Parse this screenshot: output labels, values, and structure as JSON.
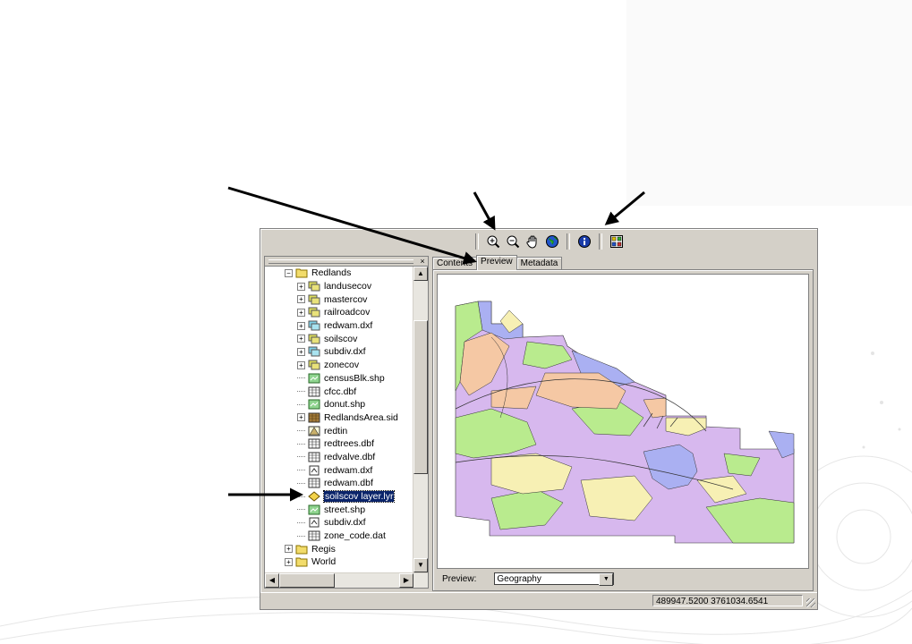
{
  "toolbar": {
    "buttons": [
      {
        "name": "zoom-in-icon"
      },
      {
        "name": "zoom-out-icon"
      },
      {
        "name": "pan-hand-icon"
      },
      {
        "name": "full-extent-globe-icon"
      },
      {
        "name": "identify-icon"
      },
      {
        "name": "create-thumbnail-icon"
      }
    ]
  },
  "tree": {
    "close_label": "×",
    "items": [
      {
        "label": "Redlands",
        "indent": 0,
        "expander": "-",
        "icon": "folder"
      },
      {
        "label": "landusecov",
        "indent": 1,
        "expander": "+",
        "icon": "coverage"
      },
      {
        "label": "mastercov",
        "indent": 1,
        "expander": "+",
        "icon": "coverage"
      },
      {
        "label": "railroadcov",
        "indent": 1,
        "expander": "+",
        "icon": "coverage"
      },
      {
        "label": "redwam.dxf",
        "indent": 1,
        "expander": "+",
        "icon": "cad"
      },
      {
        "label": "soilscov",
        "indent": 1,
        "expander": "+",
        "icon": "coverage"
      },
      {
        "label": "subdiv.dxf",
        "indent": 1,
        "expander": "+",
        "icon": "cad"
      },
      {
        "label": "zonecov",
        "indent": 1,
        "expander": "+",
        "icon": "coverage"
      },
      {
        "label": "censusBlk.shp",
        "indent": 1,
        "expander": "",
        "icon": "shapefile"
      },
      {
        "label": "cfcc.dbf",
        "indent": 1,
        "expander": "",
        "icon": "table"
      },
      {
        "label": "donut.shp",
        "indent": 1,
        "expander": "",
        "icon": "shapefile"
      },
      {
        "label": "RedlandsArea.sid",
        "indent": 1,
        "expander": "+",
        "icon": "raster"
      },
      {
        "label": "redtin",
        "indent": 1,
        "expander": "",
        "icon": "tin"
      },
      {
        "label": "redtrees.dbf",
        "indent": 1,
        "expander": "",
        "icon": "table"
      },
      {
        "label": "redvalve.dbf",
        "indent": 1,
        "expander": "",
        "icon": "table"
      },
      {
        "label": "redwam.dxf",
        "indent": 1,
        "expander": "",
        "icon": "cad-file"
      },
      {
        "label": "redwam.dbf",
        "indent": 1,
        "expander": "",
        "icon": "table"
      },
      {
        "label": "soilscov layer.lyr",
        "indent": 1,
        "expander": "",
        "icon": "layer",
        "selected": true
      },
      {
        "label": "street.shp",
        "indent": 1,
        "expander": "",
        "icon": "shapefile"
      },
      {
        "label": "subdiv.dxf",
        "indent": 1,
        "expander": "",
        "icon": "cad-file"
      },
      {
        "label": "zone_code.dat",
        "indent": 1,
        "expander": "",
        "icon": "table"
      },
      {
        "label": "Regis",
        "indent": 0,
        "expander": "+",
        "icon": "folder"
      },
      {
        "label": "World",
        "indent": 0,
        "expander": "+",
        "icon": "folder"
      }
    ]
  },
  "tabs": [
    {
      "label": "Contents",
      "active": false
    },
    {
      "label": "Preview",
      "active": true
    },
    {
      "label": "Metadata",
      "active": false
    }
  ],
  "preview": {
    "label": "Preview:",
    "selected": "Geography"
  },
  "status": {
    "coordinates": "489947.5200  3761034.6541"
  },
  "colors": {
    "window_face": "#d4d0c8",
    "selection": "#0a246a",
    "map_purple": "#d7b8ee",
    "map_green": "#b9eb8e",
    "map_peach": "#f5c8a4",
    "map_yellow": "#f7f0b4",
    "map_blue": "#aab0f2"
  }
}
